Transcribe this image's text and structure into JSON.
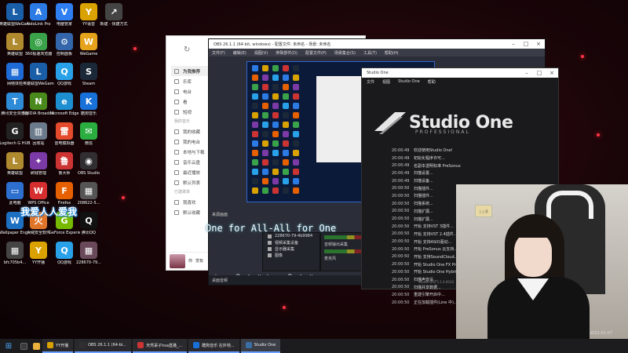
{
  "desktop": {
    "icons": [
      {
        "label": "英雄联盟WeGame版",
        "glyph": "L",
        "color": "#1a5ea8"
      },
      {
        "label": "AidoLink Pro",
        "glyph": "A",
        "color": "#2c7be5"
      },
      {
        "label": "电脑管家",
        "glyph": "V",
        "color": "#2f7ff2"
      },
      {
        "label": "YY语音",
        "glyph": "Y",
        "color": "#d9a200"
      },
      {
        "label": "新建 - 快捷方式",
        "glyph": "↗",
        "color": "#444"
      },
      {
        "label": "英雄联盟",
        "glyph": "L",
        "color": "#b08a2e"
      },
      {
        "label": "360极速浏览器",
        "glyph": "◎",
        "color": "#3aa34a"
      },
      {
        "label": "控制面板",
        "glyph": "⚙",
        "color": "#3366aa"
      },
      {
        "label": "WeGame",
        "glyph": "W",
        "color": "#e4a31b"
      },
      {
        "label": "网络体检",
        "glyph": "▦",
        "color": "#1e6bd6"
      },
      {
        "label": "英雄联盟WeGame版",
        "glyph": "L",
        "color": "#1a5ea8"
      },
      {
        "label": "QQ游戏",
        "glyph": "Q",
        "color": "#29a1e8"
      },
      {
        "label": "Steam",
        "glyph": "S",
        "color": "#1b2838"
      },
      {
        "label": "腾讯安全浏览器",
        "glyph": "T",
        "color": "#2e8bd8"
      },
      {
        "label": "NVIDIA Broadcast",
        "glyph": "N",
        "color": "#4a8a1c"
      },
      {
        "label": "Microsoft Edge",
        "glyph": "e",
        "color": "#1d8fd1"
      },
      {
        "label": "酷狗音乐",
        "glyph": "K",
        "color": "#1870d9"
      },
      {
        "label": "Logitech G HUB",
        "glyph": "G",
        "color": "#222"
      },
      {
        "label": "回收站",
        "glyph": "▥",
        "color": "#6b7b8c"
      },
      {
        "label": "雷电模拟器",
        "glyph": "雷",
        "color": "#e34b2c"
      },
      {
        "label": "微信",
        "glyph": "✉",
        "color": "#2aae3f"
      },
      {
        "label": "英雄联盟",
        "glyph": "L",
        "color": "#b08a2e"
      },
      {
        "label": "刷钱管理",
        "glyph": "✦",
        "color": "#7b3aa6"
      },
      {
        "label": "鲁大师",
        "glyph": "鲁",
        "color": "#c33"
      },
      {
        "label": "OBS Studio",
        "glyph": "◉",
        "color": "#302e31"
      },
      {
        "label": "此电脑",
        "glyph": "▭",
        "color": "#2c6fcf"
      },
      {
        "label": "WPS Office",
        "glyph": "W",
        "color": "#d62e2e"
      },
      {
        "label": "Firefox",
        "glyph": "F",
        "color": "#e66000"
      },
      {
        "label": "208622-5...",
        "glyph": "▦",
        "color": "#555"
      },
      {
        "label": "Wallpaper Engine: ...",
        "glyph": "W",
        "color": "#1d6fc2"
      },
      {
        "label": "火绒安全软件",
        "glyph": "火",
        "color": "#e0752a"
      },
      {
        "label": "GeForce Experience",
        "glyph": "G",
        "color": "#76b900"
      },
      {
        "label": "腾讯QQ",
        "glyph": "Q",
        "color": "#111"
      },
      {
        "label": "bfc705b4...",
        "glyph": "▦",
        "color": "#444"
      },
      {
        "label": "YY开播",
        "glyph": "Y",
        "color": "#d9a200"
      },
      {
        "label": "QQ游戏",
        "glyph": "Q",
        "color": "#29a1e8"
      },
      {
        "label": "228670-79...",
        "glyph": "▦",
        "color": "#6a4a5a"
      }
    ]
  },
  "brand_text": "我爱人人爱我",
  "music_window": {
    "refresh": "↻",
    "nav": [
      {
        "label": "为我推荐",
        "active": true
      },
      {
        "label": "乐库",
        "active": false
      },
      {
        "label": "电台",
        "active": false
      },
      {
        "label": "看",
        "active": false
      },
      {
        "label": "短视",
        "active": false
      }
    ],
    "section_my": "我的音乐",
    "my_items": [
      "我的收藏",
      "我的电台",
      "本地与下载",
      "音乐云盘",
      "最近播放",
      "默认列表"
    ],
    "section_playlists": "已建歌单",
    "playlist_items": [
      "我喜欢",
      "默认收藏"
    ],
    "user_labels": [
      "你",
      "觉有"
    ]
  },
  "obs": {
    "title": "OBS 26.1.1 (64-bit, windows) - 配置文件: 未命名 - 场景: 未命名",
    "menu": [
      "文件(F)",
      "编辑(E)",
      "视图(V)",
      "停靠部件(D)",
      "配置文件(P)",
      "场景集合(S)",
      "工具(T)",
      "帮助(H)"
    ],
    "scenes_label": "来源画面",
    "sources": [
      "228670-79-4b9984",
      "视频采集设备",
      "显示器采集",
      "图像"
    ],
    "mixer": [
      "音频输出采集",
      "麦克风"
    ],
    "status": "桌面音频",
    "tools": "+ − ⚙ ∧ ∨"
  },
  "studio_one": {
    "title": "Studio One",
    "menu": [
      "文件",
      "视图",
      "Studio One",
      "帮助"
    ],
    "logo_text": "Studio One",
    "logo_sub": "PROFESSIONAL",
    "log": [
      {
        "t": "20:00:49",
        "msg": "欢迎使用Studio One!"
      },
      {
        "t": "20:00:49",
        "msg": "初始化程序许可..."
      },
      {
        "t": "20:00:49",
        "msg": "名副本透明标准 PreSonus"
      },
      {
        "t": "20:00:49",
        "msg": "扫描设置..."
      },
      {
        "t": "20:00:49",
        "msg": "扫描设备..."
      },
      {
        "t": "20:00:50",
        "msg": "扫描插件..."
      },
      {
        "t": "20:00:50",
        "msg": "扫描插件..."
      },
      {
        "t": "20:00:50",
        "msg": "扫描系统..."
      },
      {
        "t": "20:00:50",
        "msg": "扫描扩展..."
      },
      {
        "t": "20:00:50",
        "msg": "扫描扩展..."
      },
      {
        "t": "20:00:50",
        "msg": "开始 支持VST 3插件..."
      },
      {
        "t": "20:00:50",
        "msg": "开始 支持VST 2.4插件..."
      },
      {
        "t": "20:00:50",
        "msg": "开始 支持ASIO驱动..."
      },
      {
        "t": "20:00:50",
        "msg": "开始 PreSonus 云支持..."
      },
      {
        "t": "20:00:50",
        "msg": "开始 支持SoundCloud..."
      },
      {
        "t": "20:00:50",
        "msg": "开始 Studio One FX Pro..."
      },
      {
        "t": "20:00:50",
        "msg": "开始 Studio One Hybrid..."
      },
      {
        "t": "20:00:50",
        "msg": "扫描声音设..."
      },
      {
        "t": "20:00:50",
        "msg": "扫描共享数据..."
      },
      {
        "t": "20:00:50",
        "msg": "重建引擎开启中..."
      },
      {
        "t": "20:00:50",
        "msg": "正在加载插件(Line 中)..."
      }
    ],
    "version": "Studio One 5.1.0.0034"
  },
  "webcam": {
    "lamp": "上上签",
    "timestamp": "2022-01-07"
  },
  "lyrics": "One for All-All for One",
  "taskbar": {
    "apps": [
      {
        "label": "YY开播",
        "color": "#d9a200",
        "active": false
      },
      {
        "label": "OBS 26.1.1 (64-bi...",
        "color": "#302e31",
        "active": false
      },
      {
        "label": "天然呆子hsa直播_...",
        "color": "#c33",
        "active": false
      },
      {
        "label": "酷狗音乐 在外地...",
        "color": "#1870d9",
        "active": false
      },
      {
        "label": "Studio One",
        "color": "#3a6ea5",
        "active": true
      }
    ]
  }
}
